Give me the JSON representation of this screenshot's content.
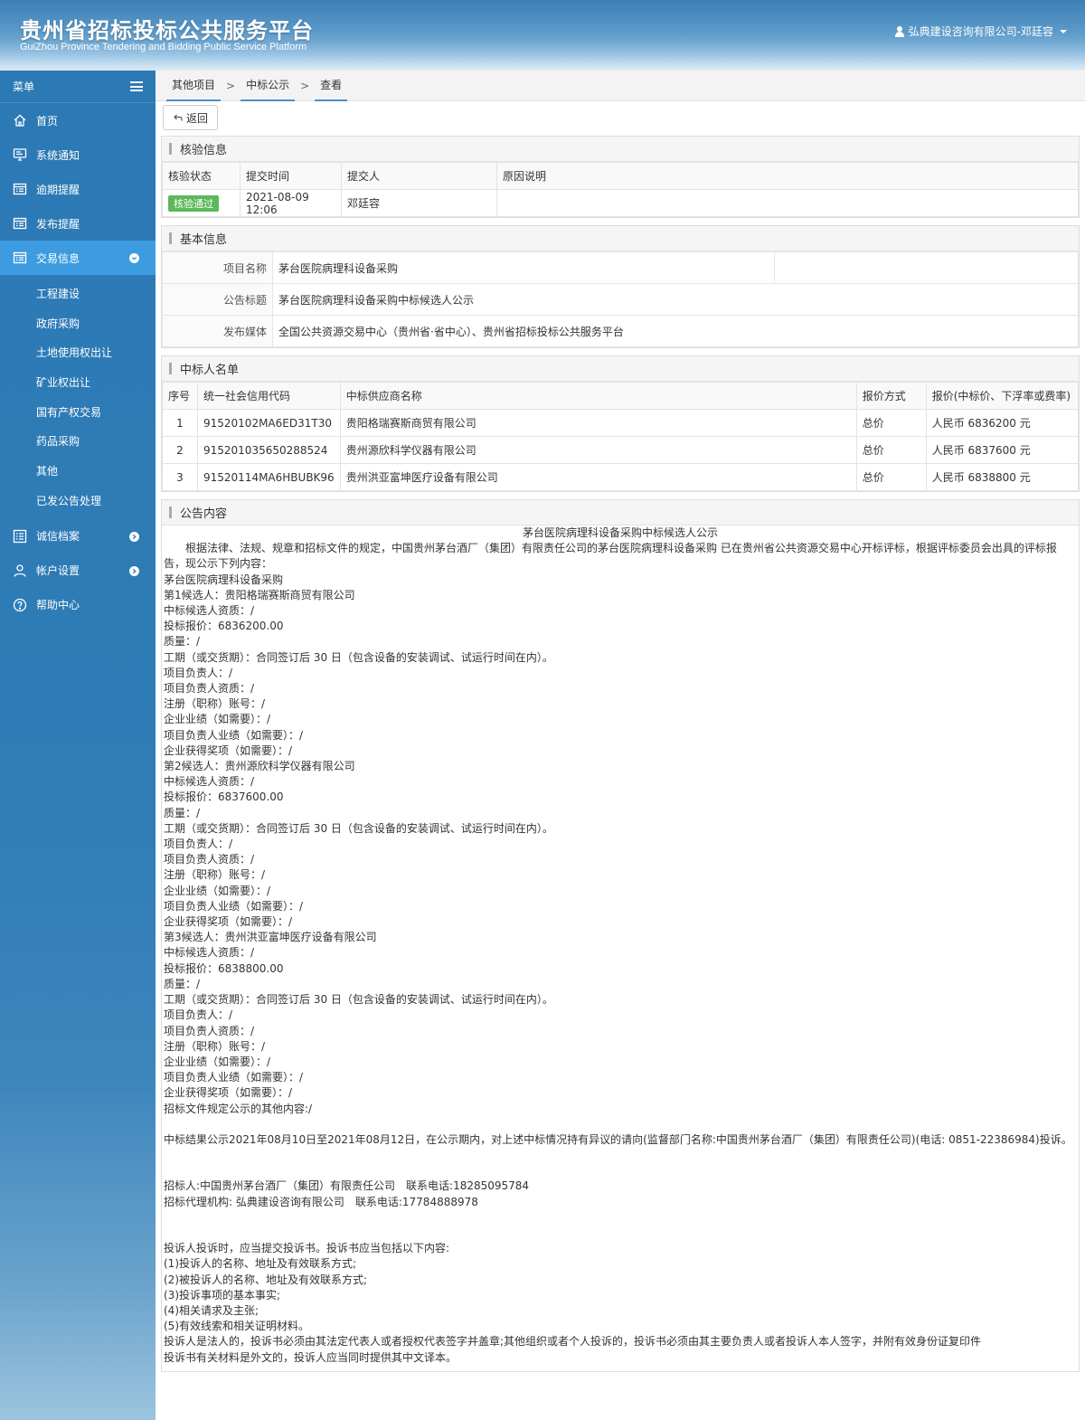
{
  "header": {
    "title": "贵州省招标投标公共服务平台",
    "subtitle": "GuiZhou Province Tendering and Bidding Public Service Platform",
    "user": "弘典建设咨询有限公司-邓廷容"
  },
  "sidebar": {
    "menu_label": "菜单",
    "items": [
      {
        "label": "首页",
        "icon": "home-icon"
      },
      {
        "label": "系统通知",
        "icon": "monitor-icon"
      },
      {
        "label": "逾期提醒",
        "icon": "list-icon"
      },
      {
        "label": "发布提醒",
        "icon": "list-icon"
      },
      {
        "label": "交易信息",
        "icon": "list-icon"
      }
    ],
    "sub_items": [
      "工程建设",
      "政府采购",
      "土地使用权出让",
      "矿业权出让",
      "国有产权交易",
      "药品采购",
      "其他",
      "已发公告处理"
    ],
    "items_after": [
      {
        "label": "诚信档案",
        "icon": "list-icon"
      },
      {
        "label": "帐户设置",
        "icon": "user-icon"
      },
      {
        "label": "帮助中心",
        "icon": "help-icon"
      }
    ]
  },
  "breadcrumb": [
    "其他项目",
    "中标公示",
    "查看"
  ],
  "toolbar": {
    "back_label": "返回"
  },
  "verify": {
    "title": "核验信息",
    "headers": [
      "核验状态",
      "提交时间",
      "提交人",
      "原因说明"
    ],
    "row": {
      "status": "核验通过",
      "time": "2021-08-09 12:06",
      "submitter": "邓廷容",
      "reason": ""
    }
  },
  "basic": {
    "title": "基本信息",
    "project_name_label": "项目名称",
    "project_name": "茅台医院病理科设备采购",
    "notice_title_label": "公告标题",
    "notice_title": "茅台医院病理科设备采购中标候选人公示",
    "media_label": "发布媒体",
    "media": "全国公共资源交易中心（贵州省·省中心）、贵州省招标投标公共服务平台"
  },
  "winners": {
    "title": "中标人名单",
    "headers": [
      "序号",
      "统一社会信用代码",
      "中标供应商名称",
      "报价方式",
      "报价(中标价、下浮率或费率)"
    ],
    "rows": [
      [
        "1",
        "91520102MA6ED31T30",
        "贵阳格瑞赛斯商贸有限公司",
        "总价",
        "人民币 6836200 元"
      ],
      [
        "2",
        "915201035650288524",
        "贵州源欣科学仪器有限公司",
        "总价",
        "人民币 6837600 元"
      ],
      [
        "3",
        "91520114MA6HBUBK96",
        "贵州洪亚富坤医疗设备有限公司",
        "总价",
        "人民币 6838800 元"
      ]
    ]
  },
  "notice": {
    "title": "公告内容",
    "heading": "茅台医院病理科设备采购中标候选人公示",
    "intro": "根据法律、法规、规章和招标文件的规定，中国贵州茅台酒厂（集团）有限责任公司的茅台医院病理科设备采购 已在贵州省公共资源交易中心开标评标，根据评标委员会出具的评标报告，现公示下列内容：",
    "lines": [
      "茅台医院病理科设备采购",
      "第1候选人：贵阳格瑞赛斯商贸有限公司",
      "中标候选人资质：/",
      "投标报价：6836200.00",
      "质量：/",
      "工期（或交货期）：合同签订后 30 日（包含设备的安装调试、试运行时间在内）。",
      "项目负责人：/",
      "项目负责人资质：/",
      "注册（职称）账号：/",
      "企业业绩（如需要）：/",
      "项目负责人业绩（如需要）：/",
      "企业获得奖项（如需要）：/",
      "第2候选人：贵州源欣科学仪器有限公司",
      "中标候选人资质：/",
      "投标报价：6837600.00",
      "质量：/",
      "工期（或交货期）：合同签订后 30 日（包含设备的安装调试、试运行时间在内）。",
      "项目负责人：/",
      "项目负责人资质：/",
      "注册（职称）账号：/",
      "企业业绩（如需要）：/",
      "项目负责人业绩（如需要）：/",
      "企业获得奖项（如需要）：/",
      "第3候选人：贵州洪亚富坤医疗设备有限公司",
      "中标候选人资质：/",
      "投标报价：6838800.00",
      "质量：/",
      "工期（或交货期）：合同签订后 30 日（包含设备的安装调试、试运行时间在内）。",
      "项目负责人：/",
      "项目负责人资质：/",
      "注册（职称）账号：/",
      "企业业绩（如需要）：/",
      "项目负责人业绩（如需要）：/",
      "企业获得奖项（如需要）：/",
      "招标文件规定公示的其他内容:/",
      "",
      "中标结果公示2021年08月10日至2021年08月12日，在公示期内，对上述中标情况持有异议的请向(监督部门名称:中国贵州茅台酒厂（集团）有限责任公司)(电话: 0851-22386984)投诉。",
      "",
      "",
      "招标人:中国贵州茅台酒厂（集团）有限责任公司　联系电话:18285095784",
      "招标代理机构: 弘典建设咨询有限公司　联系电话:17784888978",
      "",
      "",
      "投诉人投诉时，应当提交投诉书。投诉书应当包括以下内容:",
      "(1)投诉人的名称、地址及有效联系方式;",
      "(2)被投诉人的名称、地址及有效联系方式;",
      "(3)投诉事项的基本事实;",
      "(4)相关请求及主张;",
      "(5)有效线索和相关证明材料。",
      "投诉人是法人的，投诉书必须由其法定代表人或者授权代表签字并盖章;其他组织或者个人投诉的，投诉书必须由其主要负责人或者投诉人本人签字，并附有效身份证复印件",
      "投诉书有关材料是外文的，投诉人应当同时提供其中文译本。"
    ]
  },
  "colors": {
    "sidebar": "#2c7ab5",
    "active": "#3d9ce0",
    "badge": "#5cb85c"
  }
}
